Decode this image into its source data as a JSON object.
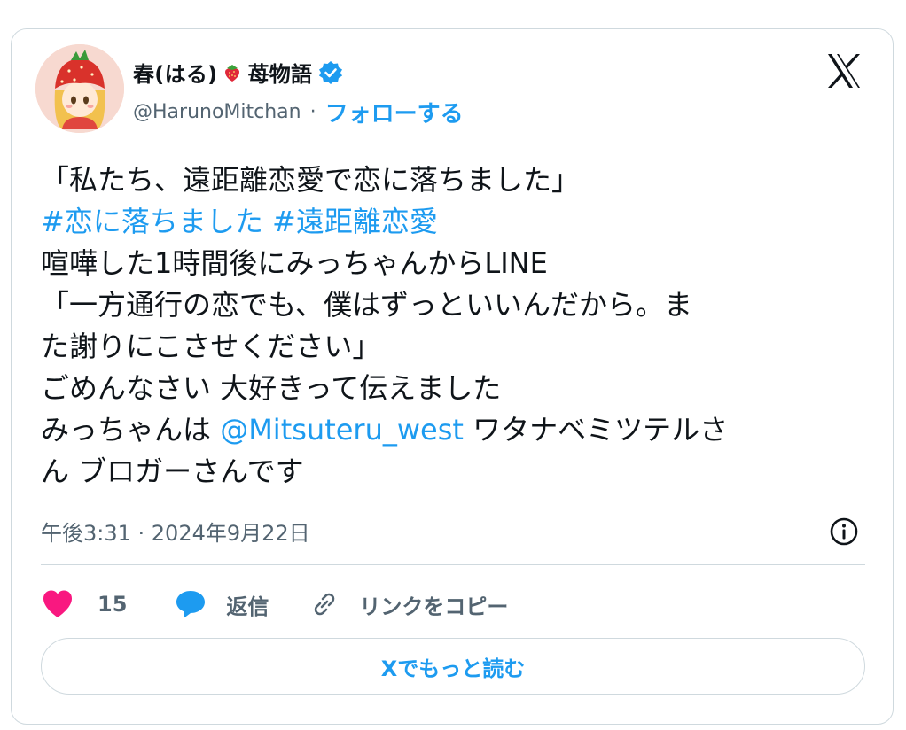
{
  "author": {
    "name_prefix": "春(はる)",
    "name_suffix": "苺物語",
    "handle": "@HarunoMitchan",
    "separator": "·",
    "follow_label": "フォローする"
  },
  "tweet": {
    "line1": "「私たち、遠距離恋愛で恋に落ちました」",
    "hashtag1": "#恋に落ちました",
    "hashtag2": "#遠距離恋愛",
    "line3": "喧嘩した1時間後にみっちゃんからLINE",
    "line4": "「一方通行の恋でも、僕はずっといいんだから。ま",
    "line5": "た謝りにこさせください」",
    "line6": "ごめんなさい 大好きって伝えました",
    "line7_prefix": "みっちゃんは ",
    "mention": "@Mitsuteru_west",
    "line7_suffix": " ワタナベミツテルさ",
    "line8": "ん ブロガーさんです"
  },
  "timestamp": "午後3:31 · 2024年9月22日",
  "actions": {
    "like_count": "15",
    "reply_label": "返信",
    "copy_link_label": "リンクをコピー"
  },
  "read_more_label": "Xでもっと読む",
  "colors": {
    "accent": "#1d9bf0",
    "like": "#f91880",
    "text": "#0f1419",
    "muted": "#536471",
    "border": "#cfd9de"
  },
  "icons": [
    "avatar",
    "strawberry-emoji-icon",
    "verified-badge-icon",
    "x-logo-icon",
    "info-icon",
    "heart-icon",
    "reply-icon",
    "link-icon"
  ]
}
